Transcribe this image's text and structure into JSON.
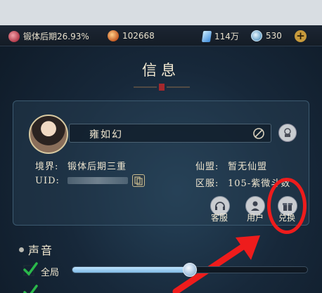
{
  "topbar": {
    "cultivation": "锻体后期26.93%",
    "power": "102668",
    "crystals": "114万",
    "coins": "530"
  },
  "title": "信息",
  "profile": {
    "name": "雍如幻",
    "realm_label": "境界:",
    "realm_value": "锻体后期三重",
    "uid_label": "UID:",
    "alliance_label": "仙盟:",
    "alliance_value": "暂无仙盟",
    "server_label": "区服:",
    "server_value": "105-紫微斗数"
  },
  "actions": {
    "service": "客服",
    "user": "用户",
    "redeem": "兑换"
  },
  "sound": {
    "title": "声音",
    "master_label": "全局",
    "master_level": 0.5
  },
  "colors": {
    "highlight": "#ee1c1c",
    "accent_gold": "#c79a3c"
  }
}
